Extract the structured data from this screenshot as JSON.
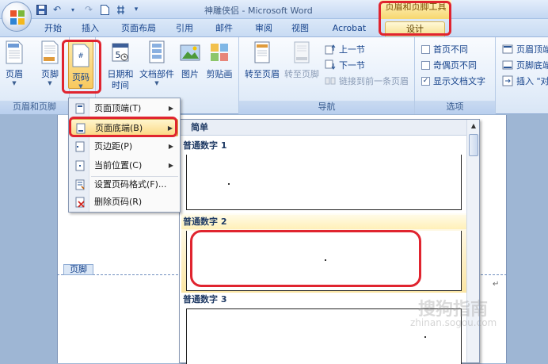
{
  "window": {
    "title": "神雕侠侣 - Microsoft Word",
    "context_tool_title": "页眉和页脚工具"
  },
  "tabs": [
    {
      "label": "开始"
    },
    {
      "label": "插入"
    },
    {
      "label": "页面布局"
    },
    {
      "label": "引用"
    },
    {
      "label": "邮件"
    },
    {
      "label": "审阅"
    },
    {
      "label": "视图"
    },
    {
      "label": "Acrobat"
    },
    {
      "label": "设计"
    }
  ],
  "ribbon": {
    "group1": {
      "label": "页眉和页脚",
      "buttons": [
        {
          "label": "页眉",
          "icon": "header-icon"
        },
        {
          "label": "页脚",
          "icon": "footer-icon"
        },
        {
          "label": "页码",
          "icon": "page-number-icon"
        }
      ]
    },
    "group2": {
      "buttons": [
        {
          "label": "日期和",
          "label2": "时间",
          "icon": "calendar-icon"
        },
        {
          "label": "文档部件",
          "icon": "document-parts-icon"
        },
        {
          "label": "图片",
          "icon": "picture-icon"
        },
        {
          "label": "剪贴画",
          "icon": "clip-art-icon"
        }
      ]
    },
    "nav": {
      "label": "导航",
      "goto_header": "转至页眉",
      "goto_footer": "转至页脚",
      "prev_section": "上一节",
      "next_section": "下一节",
      "link_previous": "链接到前一条页眉"
    },
    "options": {
      "label": "选项",
      "different_first": "首页不同",
      "different_odd_even": "奇偶页不同",
      "show_doc_text": "显示文档文字",
      "show_doc_text_checked": true
    },
    "position": {
      "header_top": "页眉顶端",
      "footer_bottom": "页脚底端",
      "insert_align": "插入 \"对"
    }
  },
  "menu": {
    "items": [
      {
        "label": "页面顶端(T)",
        "has_submenu": true
      },
      {
        "label": "页面底端(B)",
        "has_submenu": true
      },
      {
        "label": "页边距(P)",
        "has_submenu": true
      },
      {
        "label": "当前位置(C)",
        "has_submenu": true
      },
      {
        "label": "设置页码格式(F)..."
      },
      {
        "label": "删除页码(R)"
      }
    ],
    "submenu_arrow": "▶"
  },
  "gallery": {
    "section_title": "简单",
    "items": [
      {
        "label": "普通数字 1"
      },
      {
        "label": "普通数字 2"
      },
      {
        "label": "普通数字 3"
      }
    ]
  },
  "document": {
    "footer_tab": "页脚",
    "paragraph_mark": "↵"
  },
  "watermark": {
    "text": "搜狗指南",
    "sub": "zhinan.sogou.com"
  },
  "colors": {
    "highlight_red": "#e0242f",
    "context_tab": "#f5dd8a"
  }
}
